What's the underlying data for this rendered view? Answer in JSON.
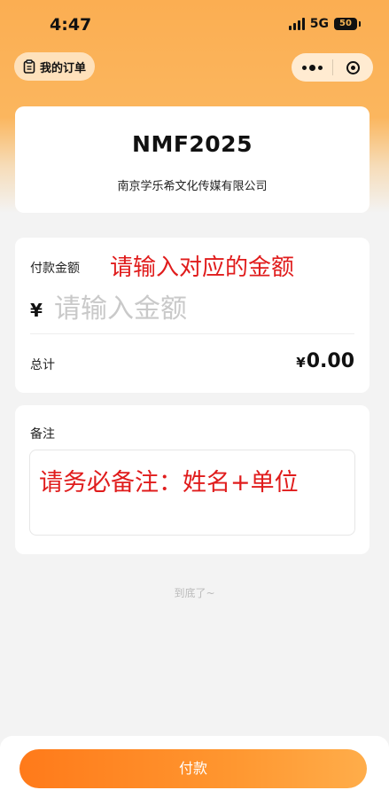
{
  "status_bar": {
    "time": "4:47",
    "network": "5G",
    "battery": "50"
  },
  "nav": {
    "orders_label": "我的订单"
  },
  "merchant": {
    "name": "NMF2025",
    "company": "南京学乐希文化传媒有限公司"
  },
  "payment": {
    "amount_label": "付款金额",
    "amount_annotation": "请输入对应的金额",
    "currency_symbol": "¥",
    "amount_placeholder": "请输入金额",
    "total_label": "总计",
    "total_currency": "¥",
    "total_value": "0.00"
  },
  "remark": {
    "label": "备注",
    "annotation": "请务必备注：姓名+单位"
  },
  "bottom_tip": "到底了~",
  "footer": {
    "pay_label": "付款"
  },
  "colors": {
    "accent": "#ff8a28",
    "annotation": "#e01c1c",
    "header": "#fbae52"
  },
  "icons": [
    "clipboard-icon",
    "more-icon",
    "close-mini-program-icon",
    "signal-icon",
    "battery-icon"
  ]
}
